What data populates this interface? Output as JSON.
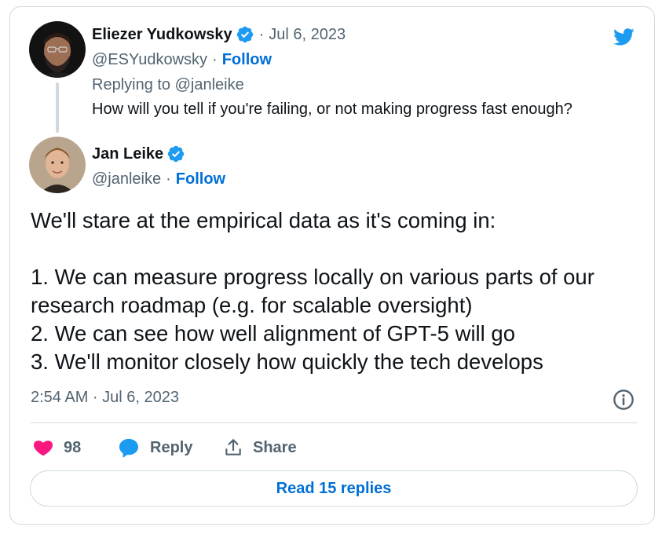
{
  "reply_tweet": {
    "author_name": "Eliezer Yudkowsky",
    "separator": "·",
    "date": "Jul 6, 2023",
    "handle": "@ESYudkowsky",
    "follow_label": "Follow",
    "replying_to": "Replying to @janleike",
    "text": "How will you tell if you're failing, or not making progress fast enough?"
  },
  "main_tweet": {
    "author_name": "Jan Leike",
    "handle": "@janleike",
    "separator": "·",
    "follow_label": "Follow",
    "lines": [
      "We'll stare at the empirical data as it's coming in:",
      "",
      "1. We can measure progress locally on various parts of our",
      "research roadmap (e.g. for scalable oversight)",
      "2. We can see how well alignment of GPT-5 will go",
      "3. We'll monitor closely how quickly the tech develops"
    ],
    "timestamp": "2:54 AM · Jul 6, 2023"
  },
  "actions": {
    "like_count": "98",
    "reply_label": "Reply",
    "share_label": "Share"
  },
  "read_replies_label": "Read 15 replies",
  "colors": {
    "link_blue": "#006fd6",
    "twitter_blue": "#1d9bf0",
    "like_pink": "#f91880",
    "muted_text": "#536471",
    "border": "#cfd9de"
  },
  "icons": [
    "twitter-bird-icon",
    "verified-badge-icon",
    "info-icon",
    "heart-icon",
    "reply-bubble-icon",
    "share-icon"
  ]
}
